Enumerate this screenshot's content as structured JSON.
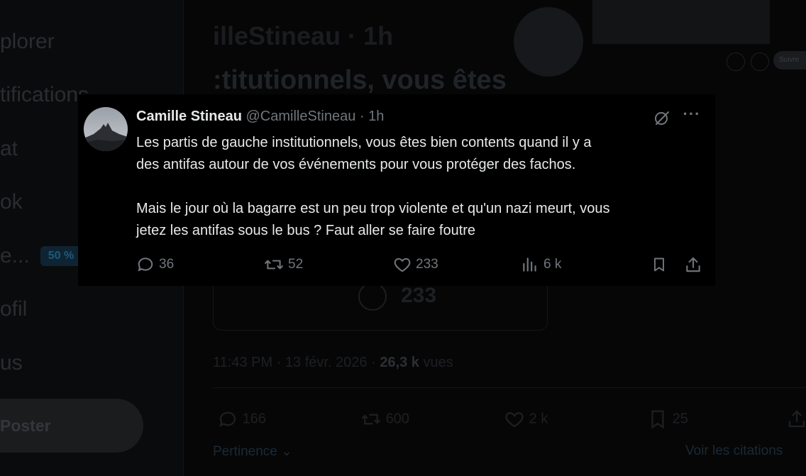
{
  "background": {
    "sidebar": {
      "items": [
        "plorer",
        "tifications",
        "at",
        "ok",
        "e...",
        "ofil",
        "us"
      ],
      "badge": "50 %",
      "post_button": "Poster"
    },
    "header_handle": "illeStineau · 1h",
    "header_text": ":titutionnels, vous êtes",
    "follow_pill": "Suivre",
    "meta": {
      "time": "11:43 PM · 13 févr. 2026 · ",
      "views_value": "26,3 k",
      "views_label": " vues"
    },
    "actions": {
      "replies": "166",
      "reposts": "600",
      "likes": "2 k",
      "bookmarks": "25"
    },
    "likes_big": "233",
    "sort_label": "Pertinence",
    "quotes_link": "Voir les citations"
  },
  "tweet": {
    "author_name": "Camille Stineau",
    "author_handle": "@CamilleStineau",
    "separator": "·",
    "time": "1h",
    "more_label": "···",
    "paragraphs": [
      [
        "Les partis de gauche institutionnels, vous êtes bien contents quand il y a",
        "des antifas autour de vos événements pour vous protéger des fachos."
      ],
      [
        "Mais le jour où la bagarre est un peu trop violente et qu'un nazi meurt, vous",
        "jetez les antifas sous le bus ? Faut aller se faire foutre"
      ]
    ],
    "stats": {
      "replies": "36",
      "reposts": "52",
      "likes": "233",
      "views": "6 k"
    }
  },
  "colors": {
    "text_primary": "#e7e9ea",
    "text_secondary": "#71767b",
    "tweet_background": "#000000",
    "page_background": "#070708"
  }
}
